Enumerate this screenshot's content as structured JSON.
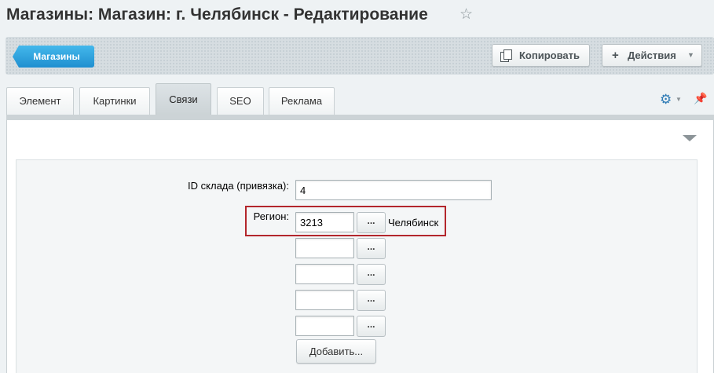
{
  "header": {
    "title": "Магазины: Магазин: г. Челябинск - Редактирование",
    "favorite_icon": "star-icon"
  },
  "toolbar": {
    "back_label": "Магазины",
    "copy_label": "Копировать",
    "actions_label": "Действия",
    "accent_color": "#2fa4e0"
  },
  "tabs": [
    {
      "label": "Элемент",
      "active": false
    },
    {
      "label": "Картинки",
      "active": false
    },
    {
      "label": "Связи",
      "active": true
    },
    {
      "label": "SEO",
      "active": false
    },
    {
      "label": "Реклама",
      "active": false
    }
  ],
  "form": {
    "warehouse_id_label": "ID склада (привязка):",
    "warehouse_id_value": "4",
    "region_label": "Регион:",
    "region_values": [
      "3213",
      "",
      "",
      "",
      ""
    ],
    "region_name": "Челябинск",
    "browse_label": "...",
    "add_label": "Добавить...",
    "highlight_color": "#b3262c"
  }
}
